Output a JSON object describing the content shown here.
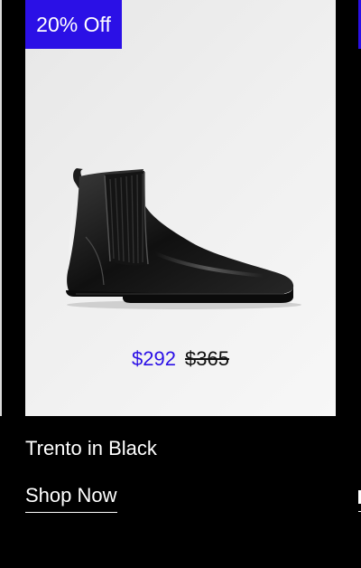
{
  "product_card": {
    "badge": "20% Off",
    "image": "black-chelsea-boot",
    "price_sale": "$292",
    "price_original": "$365",
    "name": "Trento in Black",
    "link_label": "Shop Now"
  },
  "colors": {
    "accent": "#2b10e6",
    "background": "#000000",
    "media_background": "#eeeeee",
    "text_light": "#ffffff"
  }
}
